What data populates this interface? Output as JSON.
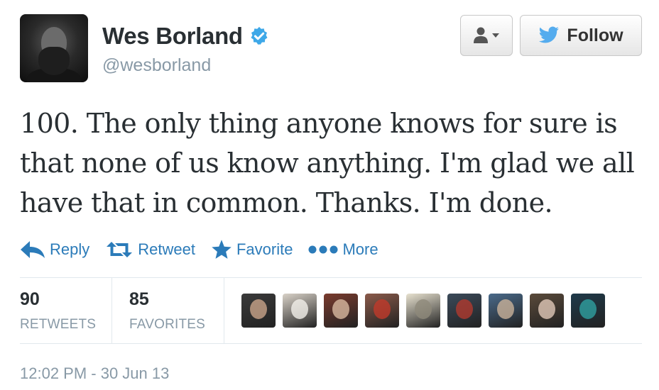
{
  "author": {
    "name": "Wes Borland",
    "handle": "@wesborland",
    "verified": true
  },
  "header_buttons": {
    "follow_label": "Follow"
  },
  "tweet": {
    "text": "100. The only thing anyone knows for sure is that none of us know anything. I'm glad we all have that in common. Thanks. I'm done."
  },
  "actions": {
    "reply": "Reply",
    "retweet": "Retweet",
    "favorite": "Favorite",
    "more": "More"
  },
  "stats": {
    "retweets_count": "90",
    "retweets_label": "RETWEETS",
    "favorites_count": "85",
    "favorites_label": "FAVORITES"
  },
  "favoriters": [
    {
      "icon": "user-avatar-1",
      "color": "#3a3a3a",
      "accent": "#c9a48a"
    },
    {
      "icon": "user-avatar-2",
      "color": "#d9d2c8",
      "accent": "#f3f0ea"
    },
    {
      "icon": "user-avatar-3",
      "color": "#7a3b2e",
      "accent": "#d8b9a0"
    },
    {
      "icon": "user-avatar-4",
      "color": "#8a5a4a",
      "accent": "#c0392b"
    },
    {
      "icon": "user-avatar-5",
      "color": "#e8e2d0",
      "accent": "#8f8a7a"
    },
    {
      "icon": "user-avatar-6",
      "color": "#3b4a5a",
      "accent": "#b03a2e"
    },
    {
      "icon": "user-avatar-7",
      "color": "#4a6a8a",
      "accent": "#c9b29a"
    },
    {
      "icon": "user-avatar-8",
      "color": "#5a4a3a",
      "accent": "#e0c8b8"
    },
    {
      "icon": "user-avatar-9",
      "color": "#1f3a4a",
      "accent": "#2fa0a0"
    }
  ],
  "timestamp": "12:02 PM - 30 Jun 13",
  "colors": {
    "link": "#2b7bb9",
    "verified": "#3ea8e8",
    "muted": "#8899a6",
    "text": "#292f33"
  }
}
